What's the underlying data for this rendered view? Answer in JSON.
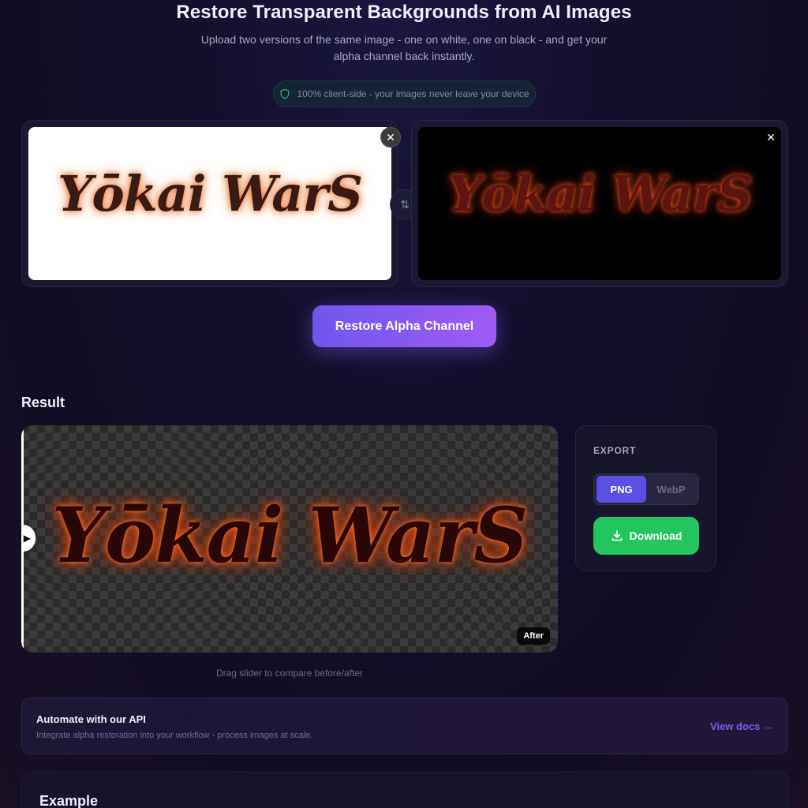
{
  "header": {
    "title": "Restore Transparent Backgrounds from AI Images",
    "subtitle": "Upload two versions of the same image - one on white, one on black - and get your alpha channel back instantly.",
    "privacy_badge": "100% client-side - your images never leave your device"
  },
  "uploads": {
    "white_preview_text": "Yōkai WarS",
    "black_preview_text": "Yōkai WarS",
    "close_symbol": "✕",
    "swap_symbol": "⇅"
  },
  "actions": {
    "restore_label": "Restore Alpha Channel"
  },
  "result": {
    "heading": "Result",
    "preview_text": "Yōkai WarS",
    "after_badge": "After",
    "slider_handle_symbol": "▶",
    "slider_hint": "Drag slider to compare before/after"
  },
  "export": {
    "label": "EXPORT",
    "formats": [
      "PNG",
      "WebP"
    ],
    "selected_format": "PNG",
    "download_label": "Download"
  },
  "api": {
    "title": "Automate with our API",
    "description": "Integrate alpha restoration into your workflow - process images at scale.",
    "link_label": "View docs →"
  },
  "example": {
    "title": "Example"
  },
  "colors": {
    "accent": "#6f57ee",
    "accent_end": "#a05af4",
    "download_green": "#22c55e",
    "format_active": "#5a50e4",
    "link": "#6f63ef"
  },
  "icons": {
    "privacy": "shield-icon",
    "swap": "swap-icon",
    "close": "close-icon",
    "download": "download-icon",
    "slider": "play-icon"
  }
}
